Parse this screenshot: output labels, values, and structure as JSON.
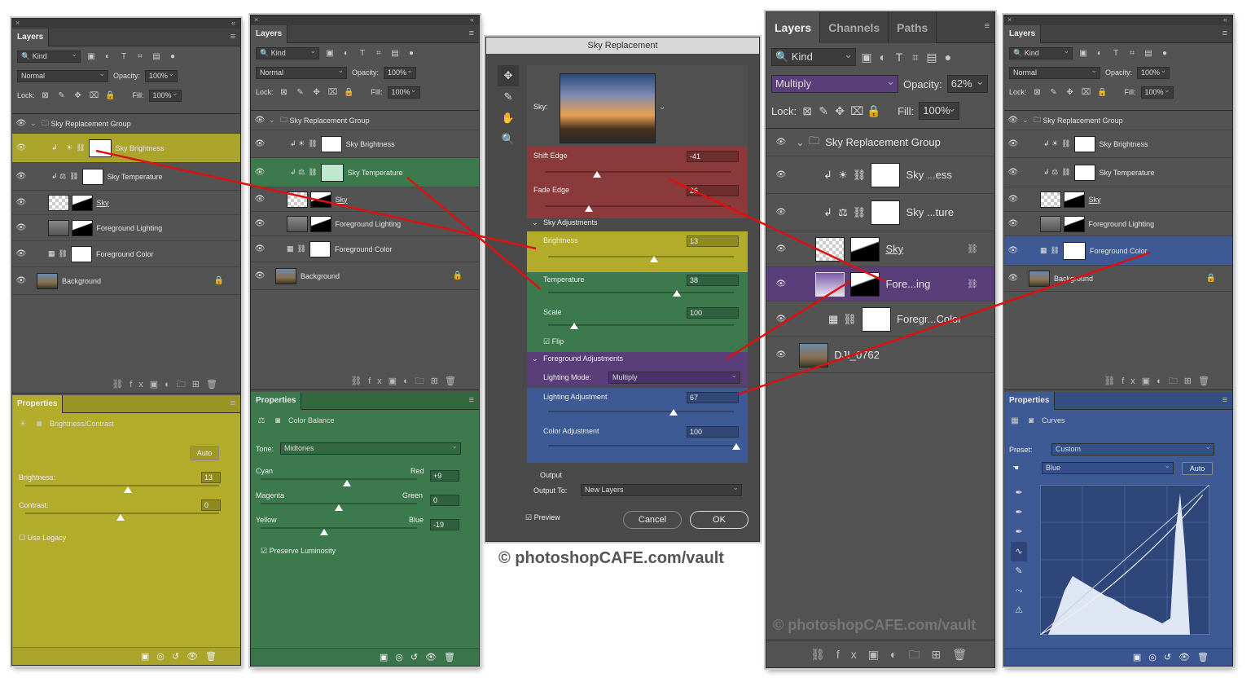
{
  "p1": {
    "tab": "Layers",
    "kind": "Kind",
    "blend": "Normal",
    "opacity_label": "Opacity:",
    "opacity": "100%",
    "lock_label": "Lock:",
    "fill_label": "Fill:",
    "fill": "100%",
    "layers": [
      "Sky Replacement Group",
      "Sky Brightness",
      "Sky Temperature",
      "Sky",
      "Foreground Lighting",
      "Foreground Color",
      "Background"
    ],
    "props_tab": "Properties",
    "props_type": "Brightness/Contrast",
    "auto": "Auto",
    "brightness_label": "Brightness:",
    "brightness": "13",
    "contrast_label": "Contrast:",
    "contrast": "0",
    "legacy": "Use Legacy"
  },
  "p2": {
    "tab": "Layers",
    "kind": "Kind",
    "blend": "Normal",
    "opacity_label": "Opacity:",
    "opacity": "100%",
    "lock_label": "Lock:",
    "fill_label": "Fill:",
    "fill": "100%",
    "layers": [
      "Sky Replacement Group",
      "Sky Brightness",
      "Sky Temperature",
      "Sky",
      "Foreground Lighting",
      "Foreground Color",
      "Background"
    ],
    "props_tab": "Properties",
    "props_type": "Color Balance",
    "tone_label": "Tone:",
    "tone": "Midtones",
    "cyan": "Cyan",
    "red": "Red",
    "cr": "+9",
    "magenta": "Magenta",
    "green": "Green",
    "mg": "0",
    "yellow": "Yellow",
    "blue": "Blue",
    "yb": "-19",
    "preserve": "Preserve Luminosity"
  },
  "dlg": {
    "title": "Sky Replacement",
    "sky_label": "Sky:",
    "shift_edge": "Shift Edge",
    "shift_val": "-41",
    "fade_edge": "Fade Edge",
    "fade_val": "26",
    "sky_adj": "Sky Adjustments",
    "brightness": "Brightness",
    "bright_val": "13",
    "temperature": "Temperature",
    "temp_val": "38",
    "scale": "Scale",
    "scale_val": "100",
    "flip": "Flip",
    "fg_adj": "Foreground Adjustments",
    "lighting_mode_label": "Lighting Mode:",
    "lighting_mode": "Multiply",
    "lighting_adj": "Lighting Adjustment",
    "lighting_val": "67",
    "color_adj": "Color Adjustment",
    "color_val": "100",
    "output": "Output",
    "output_to_label": "Output To:",
    "output_to": "New Layers",
    "preview": "Preview",
    "cancel": "Cancel",
    "ok": "OK"
  },
  "p3": {
    "tab_layers": "Layers",
    "tab_channels": "Channels",
    "tab_paths": "Paths",
    "kind": "Kind",
    "blend": "Multiply",
    "opacity_label": "Opacity:",
    "opacity": "62%",
    "lock_label": "Lock:",
    "fill_label": "Fill:",
    "fill": "100%",
    "layers": [
      "Sky Replacement Group",
      "Sky ...ess",
      "Sky ...ture",
      "Sky",
      "Fore...ing",
      "Foregr...Color",
      "DJI_0762"
    ]
  },
  "p4": {
    "tab": "Layers",
    "kind": "Kind",
    "blend": "Normal",
    "opacity_label": "Opacity:",
    "opacity": "100%",
    "lock_label": "Lock:",
    "fill_label": "Fill:",
    "fill": "100%",
    "layers": [
      "Sky Replacement Group",
      "Sky Brightness",
      "Sky Temperature",
      "Sky",
      "Foreground Lighting",
      "Foreground Color",
      "Background"
    ],
    "props_tab": "Properties",
    "props_type": "Curves",
    "preset_label": "Preset:",
    "preset": "Custom",
    "channel": "Blue",
    "auto": "Auto"
  },
  "watermark1": "© photoshopCAFE.com/vault",
  "watermark2": "© photoshopCAFE.com/vault",
  "colors": {
    "yellow": "#b2ac2a",
    "green": "#3c7a4e",
    "red": "#8a3a3a",
    "purple": "#5a3e7a",
    "blue": "#3e5a94",
    "arrow": "#e01010"
  }
}
